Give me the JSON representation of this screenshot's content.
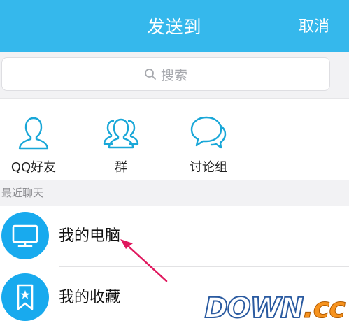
{
  "header": {
    "title": "发送到",
    "cancel_label": "取消"
  },
  "search": {
    "placeholder": "搜索"
  },
  "categories": [
    {
      "label": "QQ好友",
      "icon": "person-icon"
    },
    {
      "label": "群",
      "icon": "group-icon"
    },
    {
      "label": "讨论组",
      "icon": "chat-bubbles-icon"
    }
  ],
  "recent": {
    "section_label": "最近聊天",
    "items": [
      {
        "label": "我的电脑",
        "icon": "monitor-icon"
      },
      {
        "label": "我的收藏",
        "icon": "bookmark-star-icon"
      }
    ]
  },
  "watermark": {
    "part1": "DOWN",
    "part2": ".cc"
  },
  "colors": {
    "header": "#35b8ec",
    "accent_icon": "#19a7d8",
    "avatar": "#18aaee",
    "annotation_arrow": "#e0185e"
  }
}
